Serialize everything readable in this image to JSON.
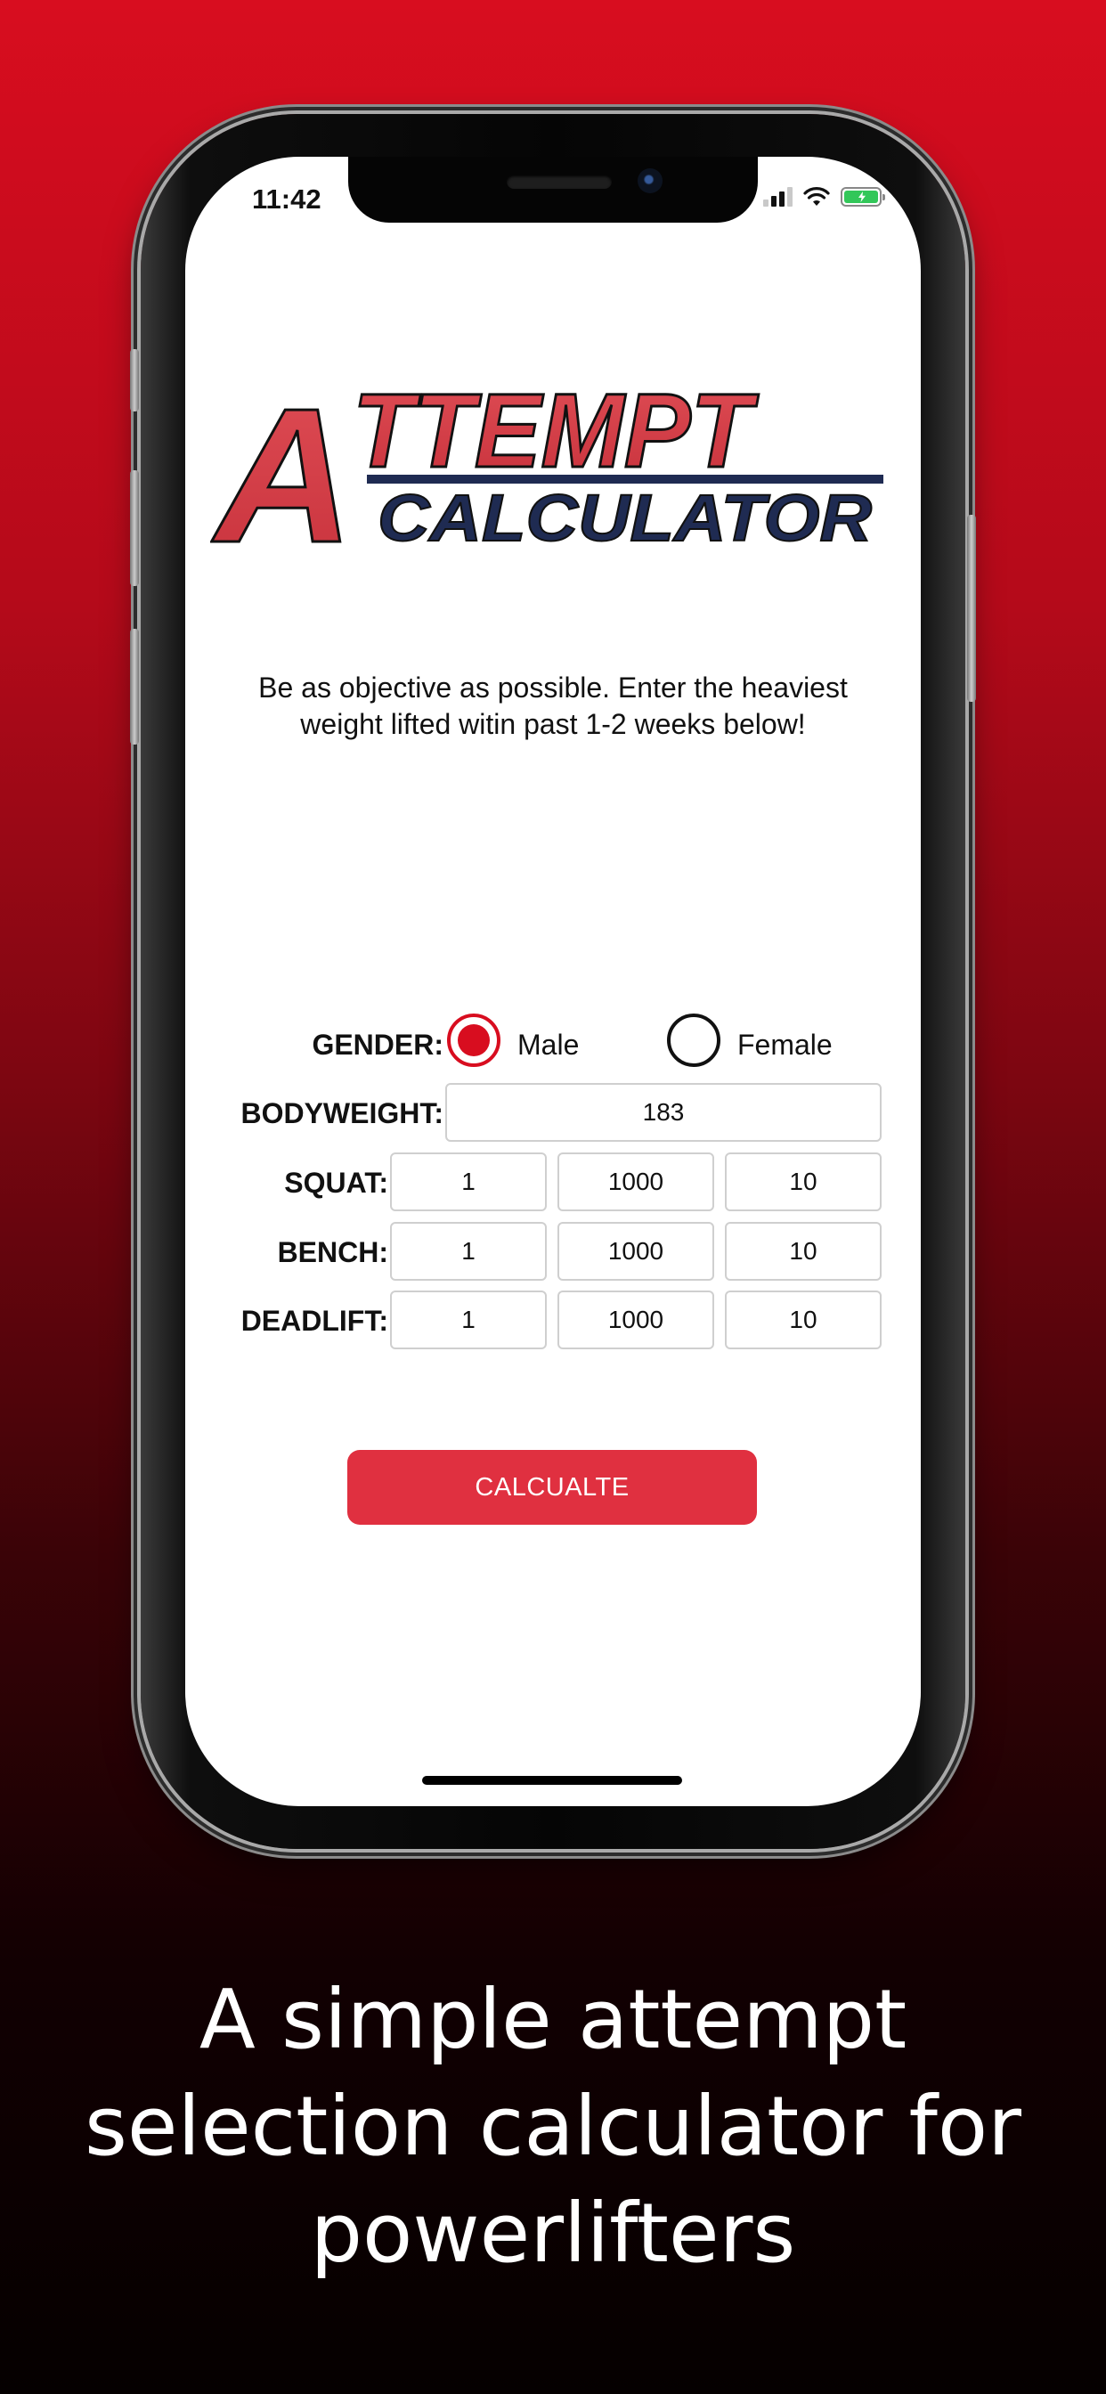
{
  "status_bar": {
    "time": "11:42"
  },
  "logo": {
    "big_letter": "A",
    "word1": "TTEMPT",
    "word2": "CALCULATOR"
  },
  "instructions": "Be as objective as possible. Enter the heaviest weight lifted witin past 1-2 weeks below!",
  "form": {
    "gender_label": "GENDER:",
    "gender_options": [
      {
        "label": "Male",
        "selected": true
      },
      {
        "label": "Female",
        "selected": false
      }
    ],
    "bodyweight_label": "BODYWEIGHT:",
    "bodyweight_value": "183",
    "lifts": [
      {
        "label": "SQUAT:",
        "values": [
          "1",
          "1000",
          "10"
        ]
      },
      {
        "label": "BENCH:",
        "values": [
          "1",
          "1000",
          "10"
        ]
      },
      {
        "label": "DEADLIFT:",
        "values": [
          "1",
          "1000",
          "10"
        ]
      }
    ]
  },
  "calculate_button": "CALCUALTE",
  "tagline": [
    "A simple attempt",
    "selection calculator for",
    "powerlifters"
  ],
  "colors": {
    "accent_red": "#e03040",
    "logo_red": "#d6404a",
    "logo_navy": "#1f2b52",
    "radio_selected": "#d80d1f"
  }
}
